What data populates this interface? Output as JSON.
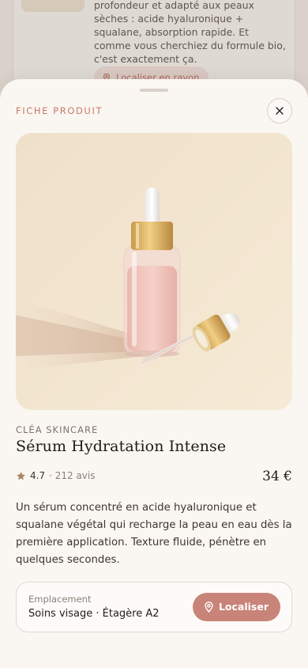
{
  "background": {
    "message": "Sélectionné pour hydrater ma peau en profondeur et adapté aux peaux sèches : acide hyaluronique + squalane, absorption rapide. Et comme vous cherchiez du formule bio, c'est exactement ça.",
    "locate_label": "Localiser en rayon"
  },
  "sheet": {
    "title": "FICHE PRODUIT",
    "close_icon": "close-icon"
  },
  "product": {
    "brand": "CLÉA SKINCARE",
    "name": "Sérum Hydratation Intense",
    "rating": "4.7",
    "reviews": "· 212 avis",
    "price": "34 €",
    "description": "Un sérum concentré en acide hyaluronique et squalane végétal qui recharge la peau en eau dès la première application. Texture fluide, pénètre en quelques secondes."
  },
  "location": {
    "label": "Emplacement",
    "value": "Soins visage · Étagère A2",
    "button_label": "Localiser"
  },
  "colors": {
    "accent": "#c98479",
    "accent_text": "#c87a68",
    "sheet_bg": "#faf6f2",
    "star": "#a88660"
  }
}
